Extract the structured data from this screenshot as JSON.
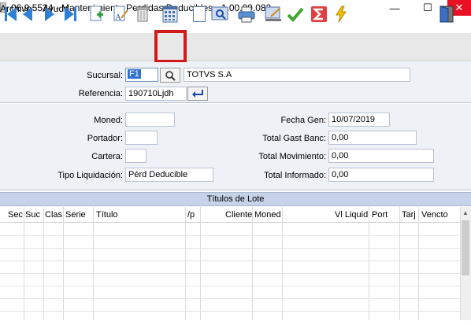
{
  "window": {
    "title": "06.9.5534 - Mantenimiento Perdidas Deducibles - 1.00.00.082",
    "minimize": "—",
    "maximize": "☐",
    "close": "✕"
  },
  "menu": {
    "items": [
      "Archivo",
      "Ayuda"
    ]
  },
  "toolbar": {
    "buttons": [
      "first-record-icon",
      "previous-record-icon",
      "next-record-icon",
      "last-record-icon",
      "new-document-icon",
      "edit-text-icon",
      "delete-trash-icon",
      "calendar-grid-icon",
      "blank-document-icon",
      "preview-icon",
      "print-icon",
      "export-icon",
      "check-icon",
      "sigma-icon",
      "lightning-icon",
      "exit-door-icon"
    ],
    "highlighted": "calendar-grid-icon",
    "highlight_color": "#d11a1a"
  },
  "header": {
    "sucursal_label": "Sucursal:",
    "sucursal_value": "F1",
    "company_name": "TOTVS S.A",
    "referencia_label": "Referencia:",
    "referencia_value": "190710Ljdh"
  },
  "details": {
    "moneda_label": "Moned:",
    "moneda_value": "",
    "portador_label": "Portador:",
    "portador_value": "",
    "cartera_label": "Cartera:",
    "cartera_value": "",
    "tipo_label": "Tipo Liquidación:",
    "tipo_value": "Pérd Deducible",
    "fecha_label": "Fecha Gen:",
    "fecha_value": "10/07/2019",
    "gast_label": "Total Gast Banc:",
    "gast_value": "0,00",
    "mov_label": "Total Movimiento:",
    "mov_value": "0,00",
    "inf_label": "Total Informado:",
    "inf_value": "0,00"
  },
  "grid": {
    "title": "Títulos de Lote",
    "columns": [
      "Sec",
      "Suc",
      "Clas",
      "Serie",
      "Título",
      "/p",
      "Cliente",
      "Moned",
      "Vl Liquid",
      "Port",
      "Tarj",
      "Vencto"
    ]
  }
}
